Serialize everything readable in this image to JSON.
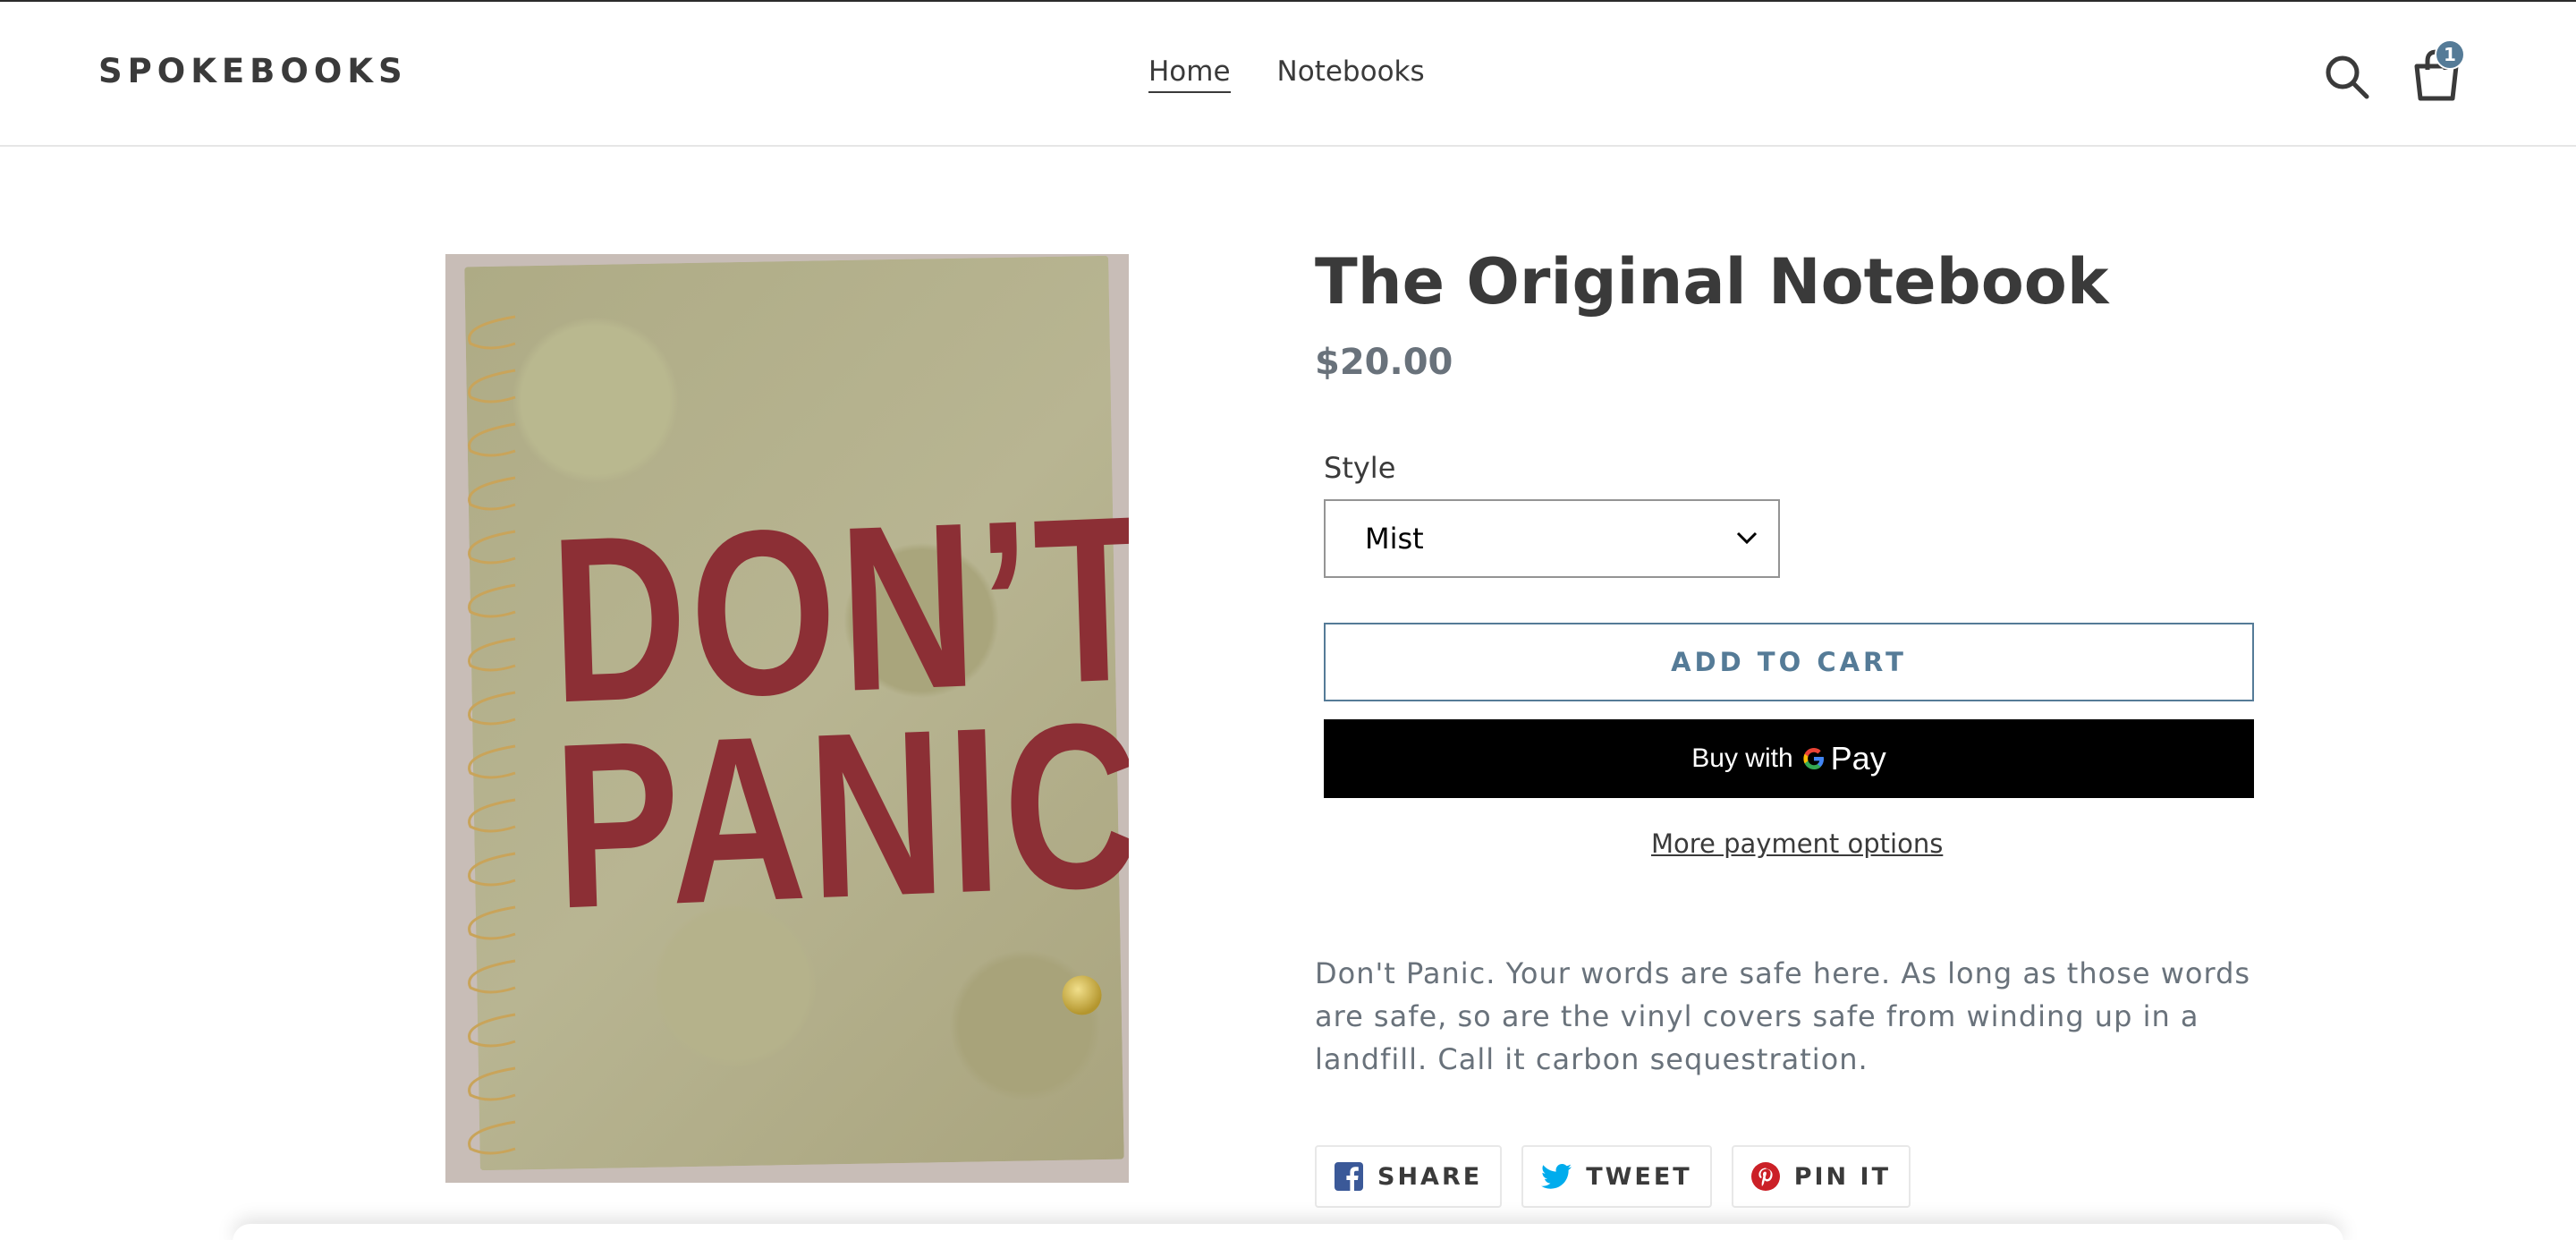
{
  "header": {
    "logo": "SPOKEBOOKS",
    "nav": [
      {
        "label": "Home",
        "active": true
      },
      {
        "label": "Notebooks",
        "active": false
      }
    ],
    "search_icon": "search-icon",
    "cart_icon": "shopping-bag-icon",
    "cart_count": "1",
    "cart_badge_color": "#557b97"
  },
  "product": {
    "title": "The Original Notebook",
    "price": "$20.00",
    "image": {
      "cover_line1": "DON’T",
      "cover_line2": "PANIC"
    },
    "style_label": "Style",
    "style_selected": "Mist",
    "add_to_cart": "ADD TO CART",
    "buy_with_prefix": "Buy with",
    "gpay_label": "Pay",
    "more_payment_options": "More payment options",
    "description": "Don't Panic. Your words are safe here. As long as those words are safe, so are the vinyl covers safe from winding up in a landfill. Call it carbon sequestration.",
    "accent_color": "#557b97"
  },
  "share": [
    {
      "label": "SHARE",
      "icon": "facebook-icon",
      "color": "#3b5998"
    },
    {
      "label": "TWEET",
      "icon": "twitter-icon",
      "color": "#00aced"
    },
    {
      "label": "PIN IT",
      "icon": "pinterest-icon",
      "color": "#cb2027"
    }
  ]
}
